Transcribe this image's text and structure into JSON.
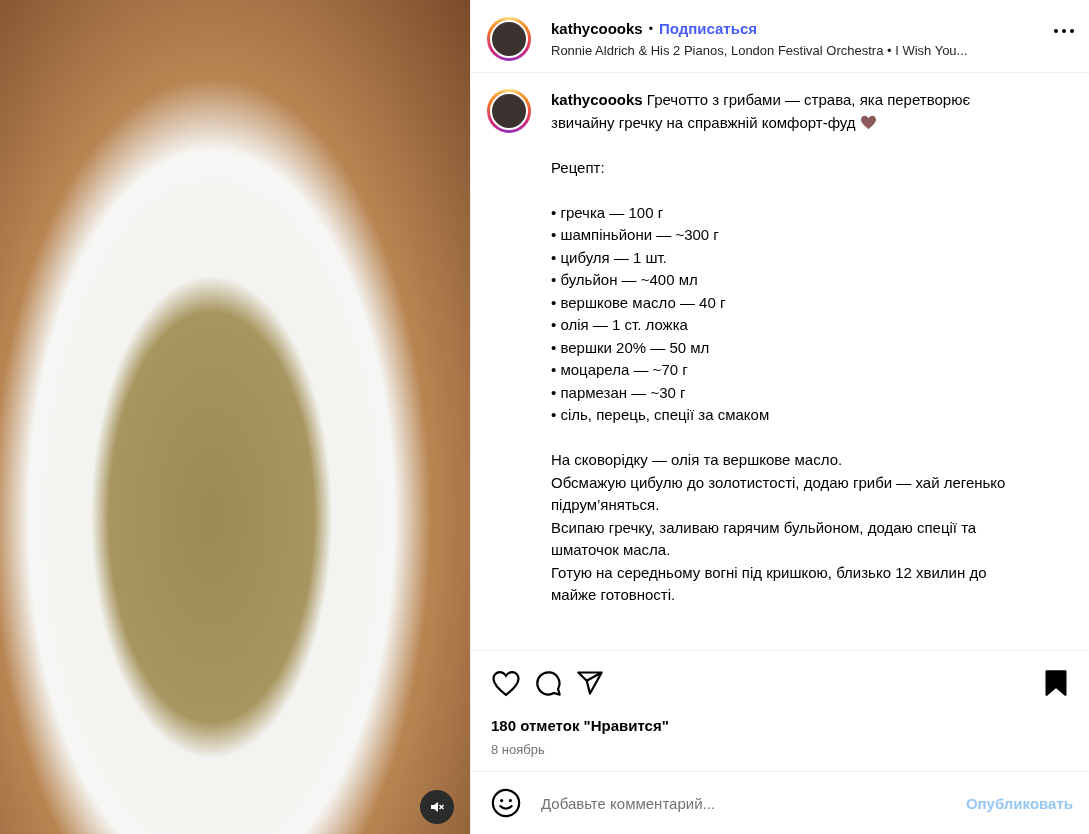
{
  "media": {
    "muted": true
  },
  "header": {
    "username": "kathycoooks",
    "separator": "•",
    "follow": "Подписаться",
    "audio": "Ronnie Aldrich & His 2 Pianos, London Festival Orchestra • I Wish You..."
  },
  "caption": {
    "username": "kathycoooks",
    "intro": "Гречотто з грибами — страва, яка перетворює звичайну гречку на справжній комфорт-фуд",
    "heading": "Рецепт:",
    "ingredients": [
      "• гречка — 100 г",
      "• шампіньйони — ~300 г",
      "• цибуля — 1 шт.",
      "• бульйон — ~400 мл",
      "• вершкове масло — 40 г",
      "• олія — 1 ст. ложка",
      "• вершки 20% — 50 мл",
      "• моцарела — ~70 г",
      "• пармезан — ~30 г",
      "• сіль, перець, спеції за смаком"
    ],
    "steps": [
      "На сковорідку — олія та вершкове масло.",
      "Обсмажую цибулю до золотистості, додаю гриби — хай легенько підрум’яняться.",
      "Всипаю гречку, заливаю гарячим бульйоном, додаю спеції та шматочок масла.",
      "Готую на середньому вогні під кришкою, близько 12 хвилин до майже готовності."
    ]
  },
  "actions": {
    "liked": false,
    "saved": true
  },
  "likes": "180 отметок \"Нравится\"",
  "date": "8 ноябрь",
  "comment": {
    "placeholder": "Добавьте комментарий...",
    "post": "Опубликовать",
    "post_disabled": true
  }
}
